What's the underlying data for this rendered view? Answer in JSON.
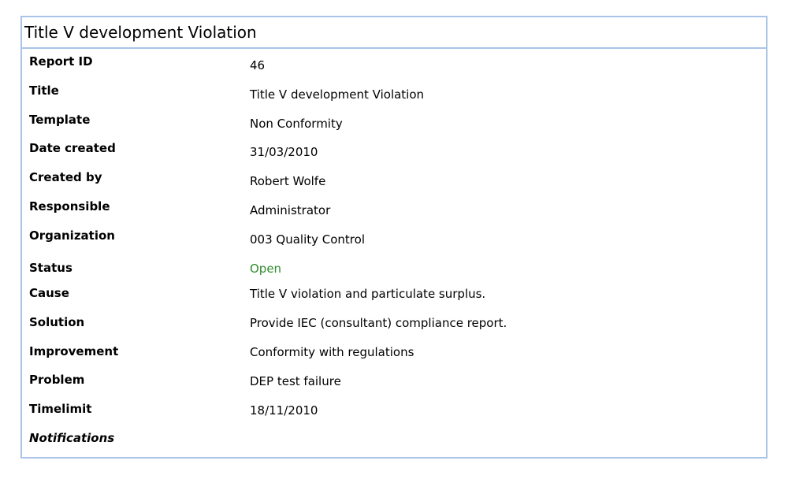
{
  "window": {
    "title": "Title V development Violation"
  },
  "colors": {
    "border": "#a9c4e8",
    "status_open": "#2e8b2e"
  },
  "fields": [
    {
      "label": "Report ID",
      "value": "46"
    },
    {
      "label": "Title",
      "value": "Title V development Violation"
    },
    {
      "label": "Template",
      "value": "Non Conformity"
    },
    {
      "label": "Date created",
      "value": "31/03/2010"
    },
    {
      "label": "Created by",
      "value": "Robert Wolfe"
    },
    {
      "label": "Responsible",
      "value": "Administrator"
    },
    {
      "label": "Organization",
      "value": "003 Quality Control"
    },
    {
      "label": "Status",
      "value": "Open"
    },
    {
      "label": "Cause",
      "value": "Title V violation and particulate surplus."
    },
    {
      "label": "Solution",
      "value": "Provide IEC (consultant) compliance report."
    },
    {
      "label": "Improvement",
      "value": "Conformity with regulations"
    },
    {
      "label": "Problem",
      "value": "DEP test failure"
    },
    {
      "label": "Timelimit",
      "value": "18/11/2010"
    }
  ],
  "notifications": {
    "label": "Notifications"
  }
}
